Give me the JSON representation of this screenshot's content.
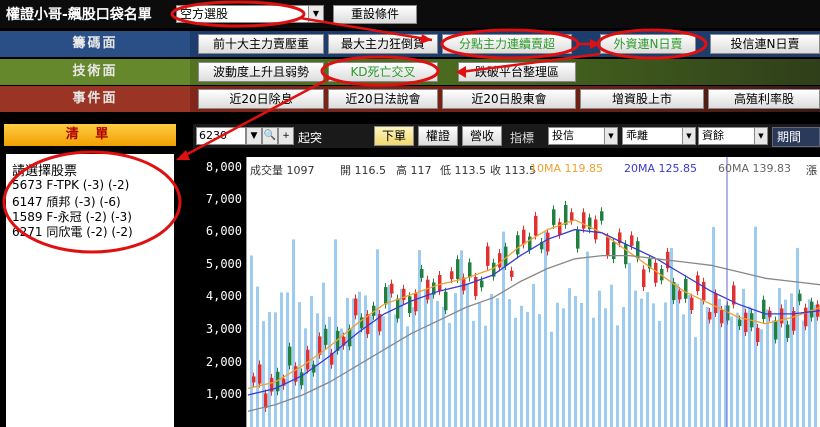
{
  "app": {
    "title": "權證小哥-飆股口袋名單",
    "strategy_value": "空方選股",
    "reset_label": "重設條件"
  },
  "categories": [
    {
      "label": "籌碼面",
      "buttons": [
        "前十大主力賣壓重",
        "最大主力狂倒貨",
        "分點主力連續賣超",
        "外資連N日賣",
        "投信連N日賣"
      ]
    },
    {
      "label": "技術面",
      "buttons": [
        "波動度上升且弱勢",
        "KD死亡交叉",
        "跌破平台整理區"
      ]
    },
    {
      "label": "事件面",
      "buttons": [
        "近20日除息",
        "近20日法說會",
        "近20日股東會",
        "增資股上市",
        "高殖利率股"
      ]
    }
  ],
  "list": {
    "header": "清 單",
    "title": "請選擇股票",
    "items": [
      {
        "code": "5673",
        "name": "F-TPK",
        "s1": "(-3)",
        "s2": "(-2)"
      },
      {
        "code": "6147",
        "name": "頎邦",
        "s1": "(-3)",
        "s2": "(-6)"
      },
      {
        "code": "1589",
        "name": "F-永冠",
        "s1": "(-2)",
        "s2": "(-3)"
      },
      {
        "code": "6271",
        "name": "同欣電",
        "s1": "(-2)",
        "s2": "(-2)"
      }
    ]
  },
  "toolbar": {
    "code_value": "6230",
    "search_icon": "magnifier-icon",
    "plus_label": "+",
    "start_label": "起突",
    "order_label": "下單",
    "warrant_label": "權證",
    "profit_label": "營收",
    "indicator_label": "指標",
    "select1": "投信",
    "select2": "乖離",
    "select3": "資餘",
    "period_label": "期間"
  },
  "chart": {
    "volume_label": "成交量 1097",
    "open_label": "開 116.5",
    "high_label": "高 117",
    "low_label": "低 113.5",
    "close_label": "收 113.5",
    "ma10_label": "10MA 119.85",
    "ma20_label": "20MA 125.85",
    "ma60_label": "60MA 139.83",
    "extra_label": "漲",
    "y_ticks": [
      "8,000",
      "7,000",
      "6,000",
      "5,000",
      "4,000",
      "3,000",
      "2,000",
      "1,000"
    ],
    "colors": {
      "ma10": "#f0a030",
      "ma20": "#3a3ad0",
      "ma60": "#888888",
      "up": "#e03030",
      "down": "#208040",
      "volume": "#9ecbf0"
    }
  },
  "chart_data": {
    "type": "candlestick",
    "y_ticks_volume": [
      1000,
      2000,
      3000,
      4000,
      5000,
      6000,
      7000,
      8000
    ],
    "ylim": [
      0,
      8000
    ],
    "price_ohlc_last": {
      "open": 116.5,
      "high": 117,
      "low": 113.5,
      "close": 113.5
    },
    "series": [
      {
        "name": "10MA",
        "values": [
          1200,
          1400,
          1900,
          2500,
          3200,
          3800,
          4100,
          4400,
          4600,
          4900,
          5600,
          6100,
          6400,
          6000,
          5400,
          4800,
          4200,
          3800,
          3400,
          3200,
          3400,
          3700
        ]
      },
      {
        "name": "20MA",
        "values": [
          1000,
          1200,
          1600,
          2200,
          2900,
          3500,
          3900,
          4200,
          4400,
          4700,
          5300,
          5800,
          6100,
          6000,
          5600,
          5200,
          4700,
          4200,
          3800,
          3500,
          3500,
          3600
        ]
      },
      {
        "name": "60MA",
        "values": [
          500,
          700,
          1000,
          1400,
          1900,
          2400,
          2900,
          3300,
          3700,
          4000,
          4500,
          4900,
          5200,
          5300,
          5300,
          5200,
          5100,
          5000,
          4800,
          4600,
          4500,
          4400
        ]
      }
    ]
  }
}
